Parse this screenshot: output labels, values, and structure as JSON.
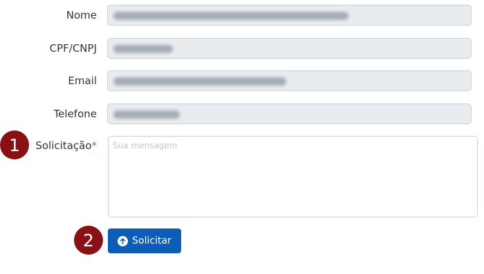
{
  "form": {
    "fields": [
      {
        "label": "Nome"
      },
      {
        "label": "CPF/CNPJ"
      },
      {
        "label": "Email"
      },
      {
        "label": "Telefone"
      }
    ],
    "request": {
      "label": "Solicitação",
      "required_mark": "*",
      "placeholder": "Sua mensagem"
    },
    "submit_label": "Solicitar"
  },
  "badges": [
    "1",
    "2"
  ],
  "colors": {
    "badge": "#8b1015",
    "button": "#0d5db7",
    "required": "#d9534f",
    "readonly_field": "#e9ecef"
  },
  "icons": {
    "submit": "arrow-up-circle-icon"
  }
}
